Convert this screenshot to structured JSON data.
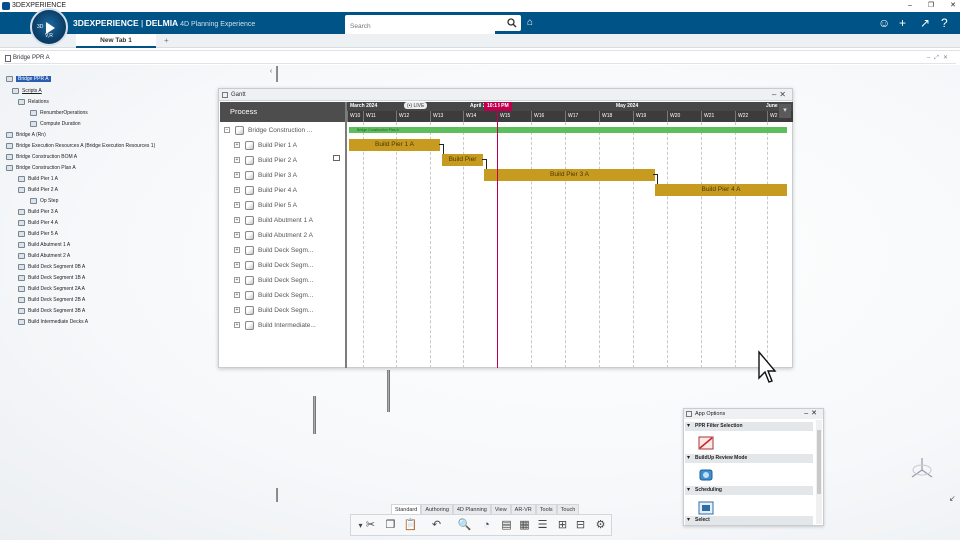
{
  "window": {
    "title": "3DEXPERIENCE",
    "controls": [
      "–",
      "❐",
      "✕"
    ]
  },
  "header": {
    "compass_label": "V,R",
    "compass_num": "3D",
    "brand_bold": "3DEXPERIENCE",
    "brand_sep": " | ",
    "brand_app_bold": "DELMIA",
    "app_name": " 4D Planning Experience",
    "search_placeholder": "Search"
  },
  "tabs": {
    "active": "New Tab 1",
    "add": "+"
  },
  "document": {
    "title": "Bridge PPR A"
  },
  "tree": {
    "items": [
      {
        "label": "Bridge PPR A",
        "selected": true
      },
      {
        "label": "Scripts A",
        "underline": true
      },
      {
        "label": "Relations"
      },
      {
        "label": "RenumberOperations"
      },
      {
        "label": "Compute Duration"
      },
      {
        "label": "Bridge A (Rn)"
      },
      {
        "label": "Bridge Execution Resources A (Bridge Execution Resources 1)"
      },
      {
        "label": "Bridge Construction BOM A"
      },
      {
        "label": "Bridge Construction Plan A"
      },
      {
        "label": "Build Pier 1 A"
      },
      {
        "label": "Build Pier 2 A"
      },
      {
        "label": "Op Step"
      },
      {
        "label": "Build Pier 3 A"
      },
      {
        "label": "Build Pier 4 A"
      },
      {
        "label": "Build Pier 5 A"
      },
      {
        "label": "Build Abutment 1 A"
      },
      {
        "label": "Build Abutment 2 A"
      },
      {
        "label": "Build Deck Segment 0B A"
      },
      {
        "label": "Build Deck Segment 1B A"
      },
      {
        "label": "Build Deck Segment 2A A"
      },
      {
        "label": "Build Deck Segment 2B A"
      },
      {
        "label": "Build Deck Segment 3B A"
      },
      {
        "label": "Build Intermediate Decks A"
      }
    ]
  },
  "gantt": {
    "title": "Gantt",
    "process_header": "Process",
    "live": "(•) LIVE",
    "now_label": "10:13 PM",
    "months": [
      "March 2024",
      "April 2",
      "May 2024",
      "June"
    ],
    "weeks": [
      "W10",
      "W11",
      "W12",
      "W13",
      "W14",
      "W15",
      "W16",
      "W17",
      "W18",
      "W19",
      "W20",
      "W21",
      "W22",
      "W2"
    ],
    "rows": [
      {
        "label": "Bridge Construction ..."
      },
      {
        "label": "Build Pier 1 A"
      },
      {
        "label": "Build Pier 2 A"
      },
      {
        "label": "Build Pier 3 A"
      },
      {
        "label": "Build Pier 4 A"
      },
      {
        "label": "Build Pier 5 A"
      },
      {
        "label": "Build Abutment 1 A"
      },
      {
        "label": "Build Abutment 2 A"
      },
      {
        "label": "Build Deck Segm..."
      },
      {
        "label": "Build Deck Segm..."
      },
      {
        "label": "Build Deck Segm..."
      },
      {
        "label": "Build Deck Segm..."
      },
      {
        "label": "Build Deck Segm..."
      },
      {
        "label": "Build Intermediate..."
      }
    ],
    "bars": [
      {
        "label": "Bridge Construction Plan A",
        "type": "summary"
      },
      {
        "label": "Build Pier 1 A"
      },
      {
        "label": "Build Pier"
      },
      {
        "label": "Build Pier 3 A"
      },
      {
        "label": "Build Pier 4 A"
      }
    ]
  },
  "app_options": {
    "title": "App Options",
    "sections": [
      "PPR Filter Selection",
      "BuildUp Review Mode",
      "Scheduling",
      "Select"
    ]
  },
  "toolbar": {
    "tabs": [
      "Standard",
      "Authoring",
      "4D Planning",
      "View",
      "AR-VR",
      "Tools",
      "Touch"
    ],
    "active_tab": "Standard"
  }
}
